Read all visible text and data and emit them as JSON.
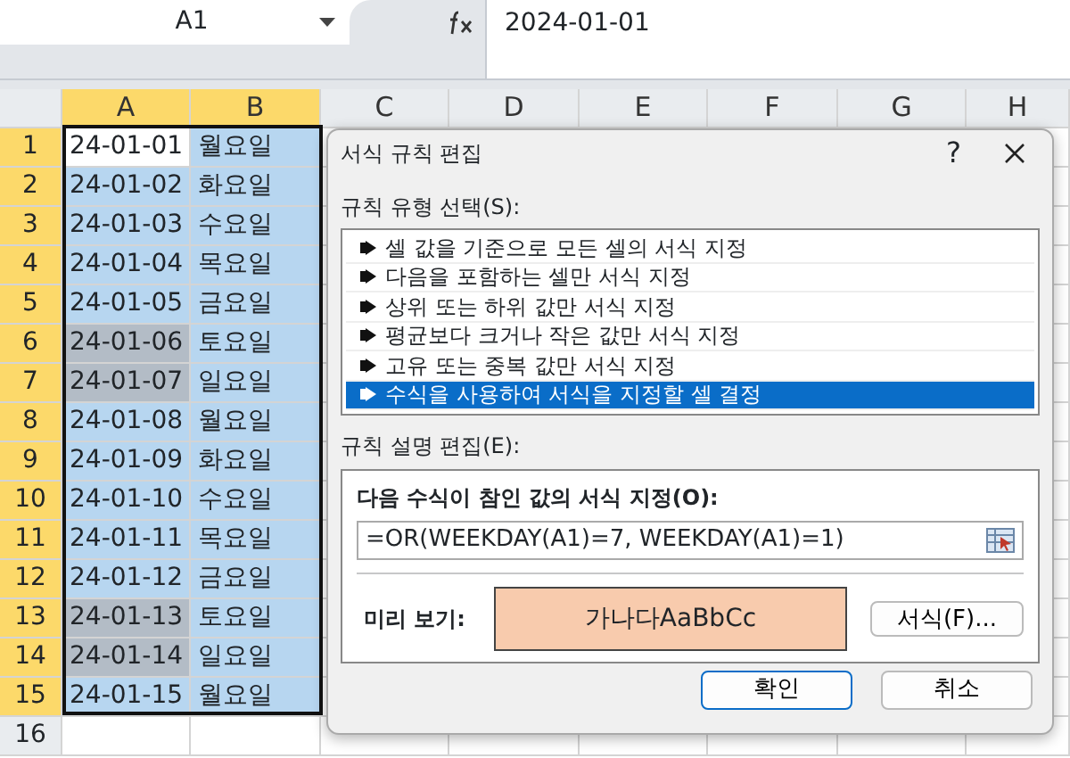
{
  "name_box": {
    "value": "A1"
  },
  "formula_bar": {
    "value": "2024-01-01"
  },
  "columns": [
    {
      "label": "A",
      "selected": true
    },
    {
      "label": "B",
      "selected": true
    },
    {
      "label": "C",
      "selected": false
    },
    {
      "label": "D",
      "selected": false
    },
    {
      "label": "E",
      "selected": false
    },
    {
      "label": "F",
      "selected": false
    },
    {
      "label": "G",
      "selected": false
    },
    {
      "label": "H",
      "selected": false
    }
  ],
  "rows": [
    {
      "number": "1",
      "date": "24-01-01",
      "day": "월요일",
      "selected": true,
      "active": true,
      "highlighted": false
    },
    {
      "number": "2",
      "date": "24-01-02",
      "day": "화요일",
      "selected": true,
      "active": false,
      "highlighted": false
    },
    {
      "number": "3",
      "date": "24-01-03",
      "day": "수요일",
      "selected": true,
      "active": false,
      "highlighted": false
    },
    {
      "number": "4",
      "date": "24-01-04",
      "day": "목요일",
      "selected": true,
      "active": false,
      "highlighted": false
    },
    {
      "number": "5",
      "date": "24-01-05",
      "day": "금요일",
      "selected": true,
      "active": false,
      "highlighted": false
    },
    {
      "number": "6",
      "date": "24-01-06",
      "day": "토요일",
      "selected": true,
      "active": false,
      "highlighted": true
    },
    {
      "number": "7",
      "date": "24-01-07",
      "day": "일요일",
      "selected": true,
      "active": false,
      "highlighted": true
    },
    {
      "number": "8",
      "date": "24-01-08",
      "day": "월요일",
      "selected": true,
      "active": false,
      "highlighted": false
    },
    {
      "number": "9",
      "date": "24-01-09",
      "day": "화요일",
      "selected": true,
      "active": false,
      "highlighted": false
    },
    {
      "number": "10",
      "date": "24-01-10",
      "day": "수요일",
      "selected": true,
      "active": false,
      "highlighted": false
    },
    {
      "number": "11",
      "date": "24-01-11",
      "day": "목요일",
      "selected": true,
      "active": false,
      "highlighted": false
    },
    {
      "number": "12",
      "date": "24-01-12",
      "day": "금요일",
      "selected": true,
      "active": false,
      "highlighted": false
    },
    {
      "number": "13",
      "date": "24-01-13",
      "day": "토요일",
      "selected": true,
      "active": false,
      "highlighted": true
    },
    {
      "number": "14",
      "date": "24-01-14",
      "day": "일요일",
      "selected": true,
      "active": false,
      "highlighted": true
    },
    {
      "number": "15",
      "date": "24-01-15",
      "day": "월요일",
      "selected": true,
      "active": false,
      "highlighted": false
    },
    {
      "number": "16",
      "selected": false
    }
  ],
  "dialog": {
    "title": "서식 규칙 편집",
    "help": "?",
    "rule_type_label": "규칙 유형 선택(S):",
    "rule_types": [
      {
        "label": "셀 값을 기준으로 모든 셀의 서식 지정",
        "selected": false
      },
      {
        "label": "다음을 포함하는 셀만 서식 지정",
        "selected": false
      },
      {
        "label": "상위 또는 하위 값만 서식 지정",
        "selected": false
      },
      {
        "label": "평균보다 크거나 작은 값만 서식 지정",
        "selected": false
      },
      {
        "label": "고유 또는 중복 값만 서식 지정",
        "selected": false
      },
      {
        "label": "수식을 사용하여 서식을 지정할 셀 결정",
        "selected": true
      }
    ],
    "description_label": "규칙 설명 편집(E):",
    "formula_label": "다음 수식이 참인 값의 서식 지정(O):",
    "formula": "=OR(WEEKDAY(A1)=7, WEEKDAY(A1)=1)",
    "preview_label": "미리 보기:",
    "preview_text": "가나다AaBbCc",
    "format_button": "서식(F)...",
    "ok_button": "확인",
    "cancel_button": "취소"
  }
}
